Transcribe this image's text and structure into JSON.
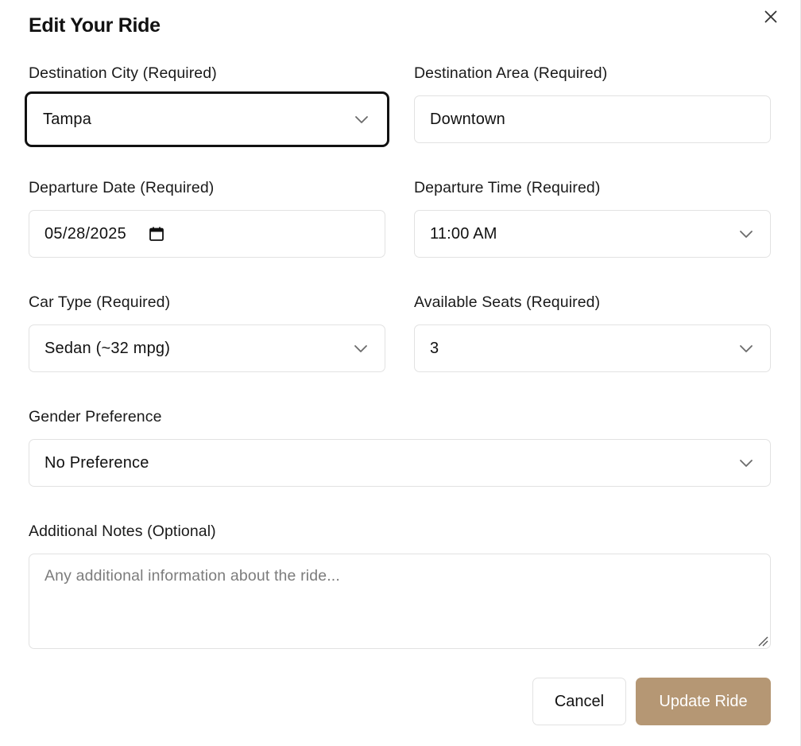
{
  "dialog": {
    "title": "Edit Your Ride",
    "close_icon": "close-icon"
  },
  "fields": {
    "destination_city": {
      "label": "Destination City (Required)",
      "value": "Tampa",
      "icon": "chevron-down-icon"
    },
    "destination_area": {
      "label": "Destination Area (Required)",
      "value": "Downtown"
    },
    "departure_date": {
      "label": "Departure Date (Required)",
      "value": "05/28/2025",
      "icon": "calendar-icon"
    },
    "departure_time": {
      "label": "Departure Time (Required)",
      "value": "11:00 AM",
      "icon": "chevron-down-icon"
    },
    "car_type": {
      "label": "Car Type (Required)",
      "value": "Sedan (~32 mpg)",
      "icon": "chevron-down-icon"
    },
    "available_seats": {
      "label": "Available Seats (Required)",
      "value": "3",
      "icon": "chevron-down-icon"
    },
    "gender_preference": {
      "label": "Gender Preference",
      "value": "No Preference",
      "icon": "chevron-down-icon"
    },
    "additional_notes": {
      "label": "Additional Notes (Optional)",
      "value": "",
      "placeholder": "Any additional information about the ride..."
    }
  },
  "actions": {
    "cancel_label": "Cancel",
    "update_label": "Update Ride"
  },
  "colors": {
    "accent": "#b59774",
    "focus_border": "#111111",
    "border": "#e2e2e2",
    "placeholder": "#7c7c7c"
  }
}
